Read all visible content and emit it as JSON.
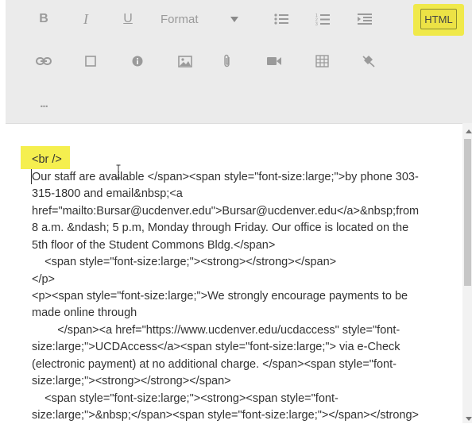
{
  "toolbar": {
    "bold_label": "B",
    "italic_label": "I",
    "underline_label": "U",
    "format_label": "Format",
    "html_label": "HTML",
    "more_label": "..."
  },
  "editor": {
    "lines": [
      "<br />",
      "Our staff are available </span><span style=\"font-size:large;\">by phone 303-",
      "315-1800 and email&nbsp;<a",
      "href=\"mailto:Bursar@ucdenver.edu\">Bursar@ucdenver.edu</a>&nbsp;from",
      "8 a.m. &ndash; 5 p.m, Monday through Friday. Our office is located on the",
      "5th floor of the Student Commons Bldg.</span>",
      "    <span style=\"font-size:large;\"><strong></strong></span>",
      "</p>",
      "<p><span style=\"font-size:large;\">We strongly encourage payments to be",
      "made online through",
      "        </span><a href=\"https://www.ucdenver.edu/ucdaccess\" style=\"font-",
      "size:large;\">UCDAccess</a><span style=\"font-size:large;\"> via e-Check",
      "(electronic payment) at no additional charge. </span><span style=\"font-",
      "size:large;\"><strong></strong></span>",
      "    <span style=\"font-size:large;\"><strong><span style=\"font-",
      "size:large;\">&nbsp;</span><span style=\"font-size:large;\"></span></strong>"
    ]
  },
  "colors": {
    "toolbar_bg": "#ebebeb",
    "highlight": "#f0e94a",
    "icon": "#9a9a9a"
  }
}
